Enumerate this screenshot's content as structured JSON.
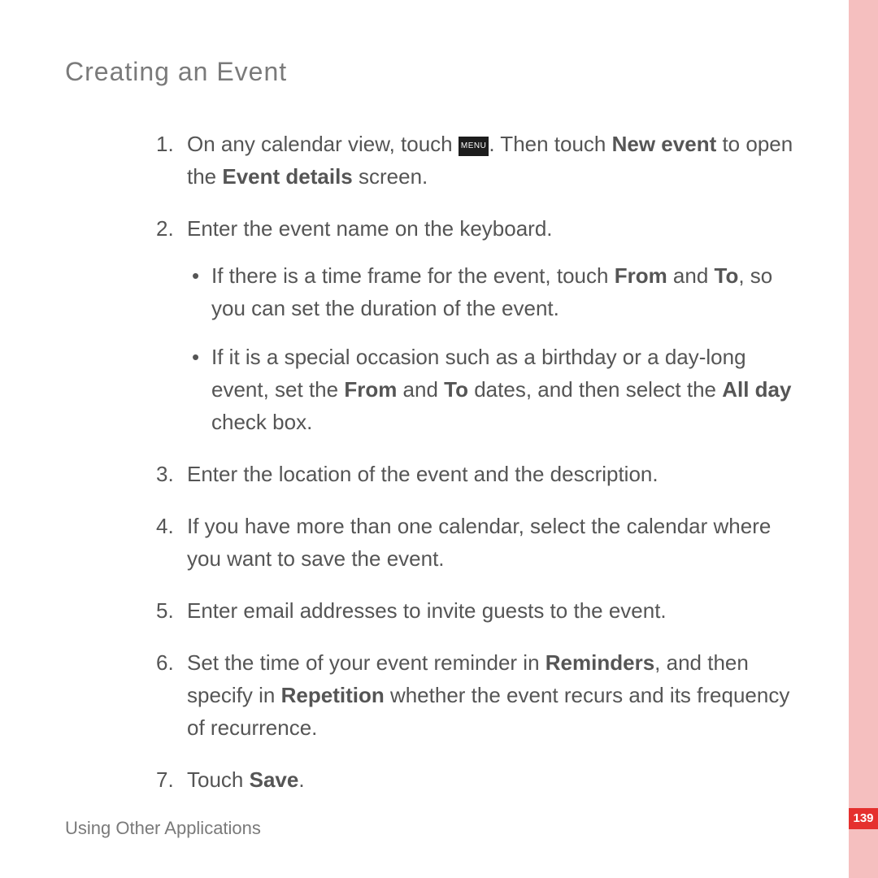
{
  "heading": "Creating  an  Event",
  "menu_key_label": "MENU",
  "steps": {
    "s1": {
      "pre": "On any calendar view, touch ",
      "post_a": ". Then touch ",
      "bold_a": "New event",
      "post_b": " to open the ",
      "bold_b": "Event details",
      "post_c": " screen."
    },
    "s2": {
      "text": "Enter the event name on the keyboard.",
      "bullets": {
        "b1": {
          "pre": "If there is a time frame for the event, touch ",
          "bold_a": "From",
          "mid_a": " and ",
          "bold_b": "To",
          "post": ", so you can set the duration of the event."
        },
        "b2": {
          "pre": "If it is a special occasion such as a birthday or a day-long event, set the ",
          "bold_a": "From",
          "mid_a": " and ",
          "bold_b": "To",
          "mid_b": " dates, and then select the ",
          "bold_c": "All day",
          "post": " check box."
        }
      }
    },
    "s3": {
      "text": "Enter the location of the event and the description."
    },
    "s4": {
      "text": "If you have more than one calendar, select the calendar where you want to save the event."
    },
    "s5": {
      "text": "Enter email addresses to invite guests to the event."
    },
    "s6": {
      "pre": "Set the time of your event reminder in ",
      "bold_a": "Reminders",
      "mid_a": ", and then specify in ",
      "bold_b": "Repetition",
      "post": " whether the event recurs and its frequency of recurrence."
    },
    "s7": {
      "pre": "Touch ",
      "bold_a": "Save",
      "post": "."
    }
  },
  "footer": "Using Other Applications",
  "page_number": "139"
}
